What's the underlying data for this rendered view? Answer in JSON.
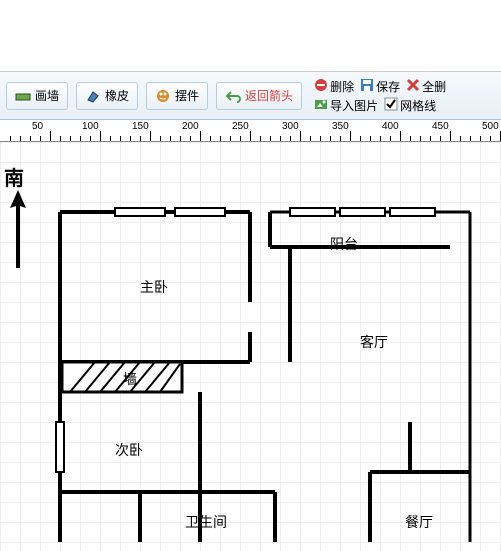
{
  "toolbar": {
    "draw_wall": "画墙",
    "eraser": "橡皮",
    "furniture": "摆件",
    "back_arrow": "返回箭头",
    "delete": "删除",
    "save": "保存",
    "delete_all": "全删",
    "import_image": "导入图片",
    "gridlines": "网格线"
  },
  "ruler": {
    "ticks": [
      "50",
      "100",
      "150",
      "200",
      "250",
      "300",
      "350",
      "400",
      "450",
      "500"
    ]
  },
  "compass": "南",
  "rooms": {
    "balcony": "阳台",
    "master_bedroom": "主卧",
    "living_room": "客厅",
    "wall": "墙",
    "second_bedroom": "次卧",
    "bathroom": "卫生间",
    "dining_room": "餐厅"
  }
}
